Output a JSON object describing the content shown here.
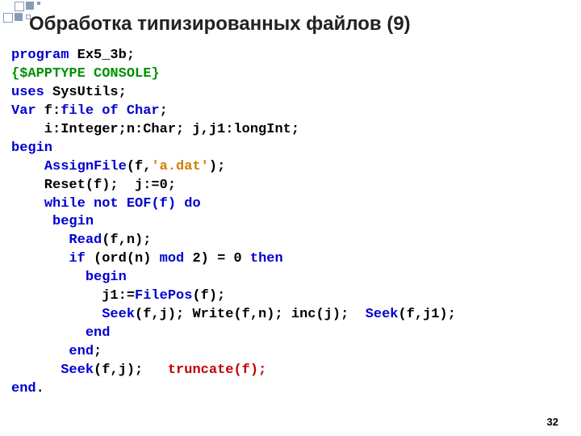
{
  "title": "Обработка типизированных файлов (9)",
  "pagenum": "32",
  "code": {
    "l1a": "program",
    "l1b": " Ex5_3b;",
    "l2": "{$APPTYPE CONSOLE}",
    "l3a": "uses",
    "l3b": " SysUtils;",
    "l4a": "Var",
    "l4b": " f:",
    "l4c": "file of Char",
    "l4d": ";",
    "l5": "    i:Integer;n:Char; j,j1:longInt;",
    "l6": "begin",
    "l7a": "    ",
    "l7b": "AssignFile",
    "l7c": "(f,",
    "l7d": "'a.dat'",
    "l7e": ");",
    "l8": "    Reset(f);  j:=0;",
    "l9a": "    ",
    "l9b": "while not",
    "l9c": " ",
    "l9d": "EOF(f)",
    "l9e": " ",
    "l9f": "do",
    "l10a": "     ",
    "l10b": "begin",
    "l11a": "       ",
    "l11b": "Read",
    "l11c": "(f,n);",
    "l12a": "       ",
    "l12b": "if",
    "l12c": " (ord(n) ",
    "l12d": "mod",
    "l12e": " 2) = 0 ",
    "l12f": "then",
    "l13a": "         ",
    "l13b": "begin",
    "l14a": "           j1:=",
    "l14b": "FilePos",
    "l14c": "(f);",
    "l15a": "           ",
    "l15b": "Seek",
    "l15c": "(f,j); Write(f,n); inc(j);  ",
    "l15d": "Seek",
    "l15e": "(f,j1);",
    "l16a": "         ",
    "l16b": "end",
    "l17a": "       ",
    "l17b": "end",
    "l17c": ";",
    "l18a": "      ",
    "l18b": "Seek",
    "l18c": "(f,j);   ",
    "l18d": "truncate(f);",
    "l19a": "end",
    "l19b": "."
  }
}
